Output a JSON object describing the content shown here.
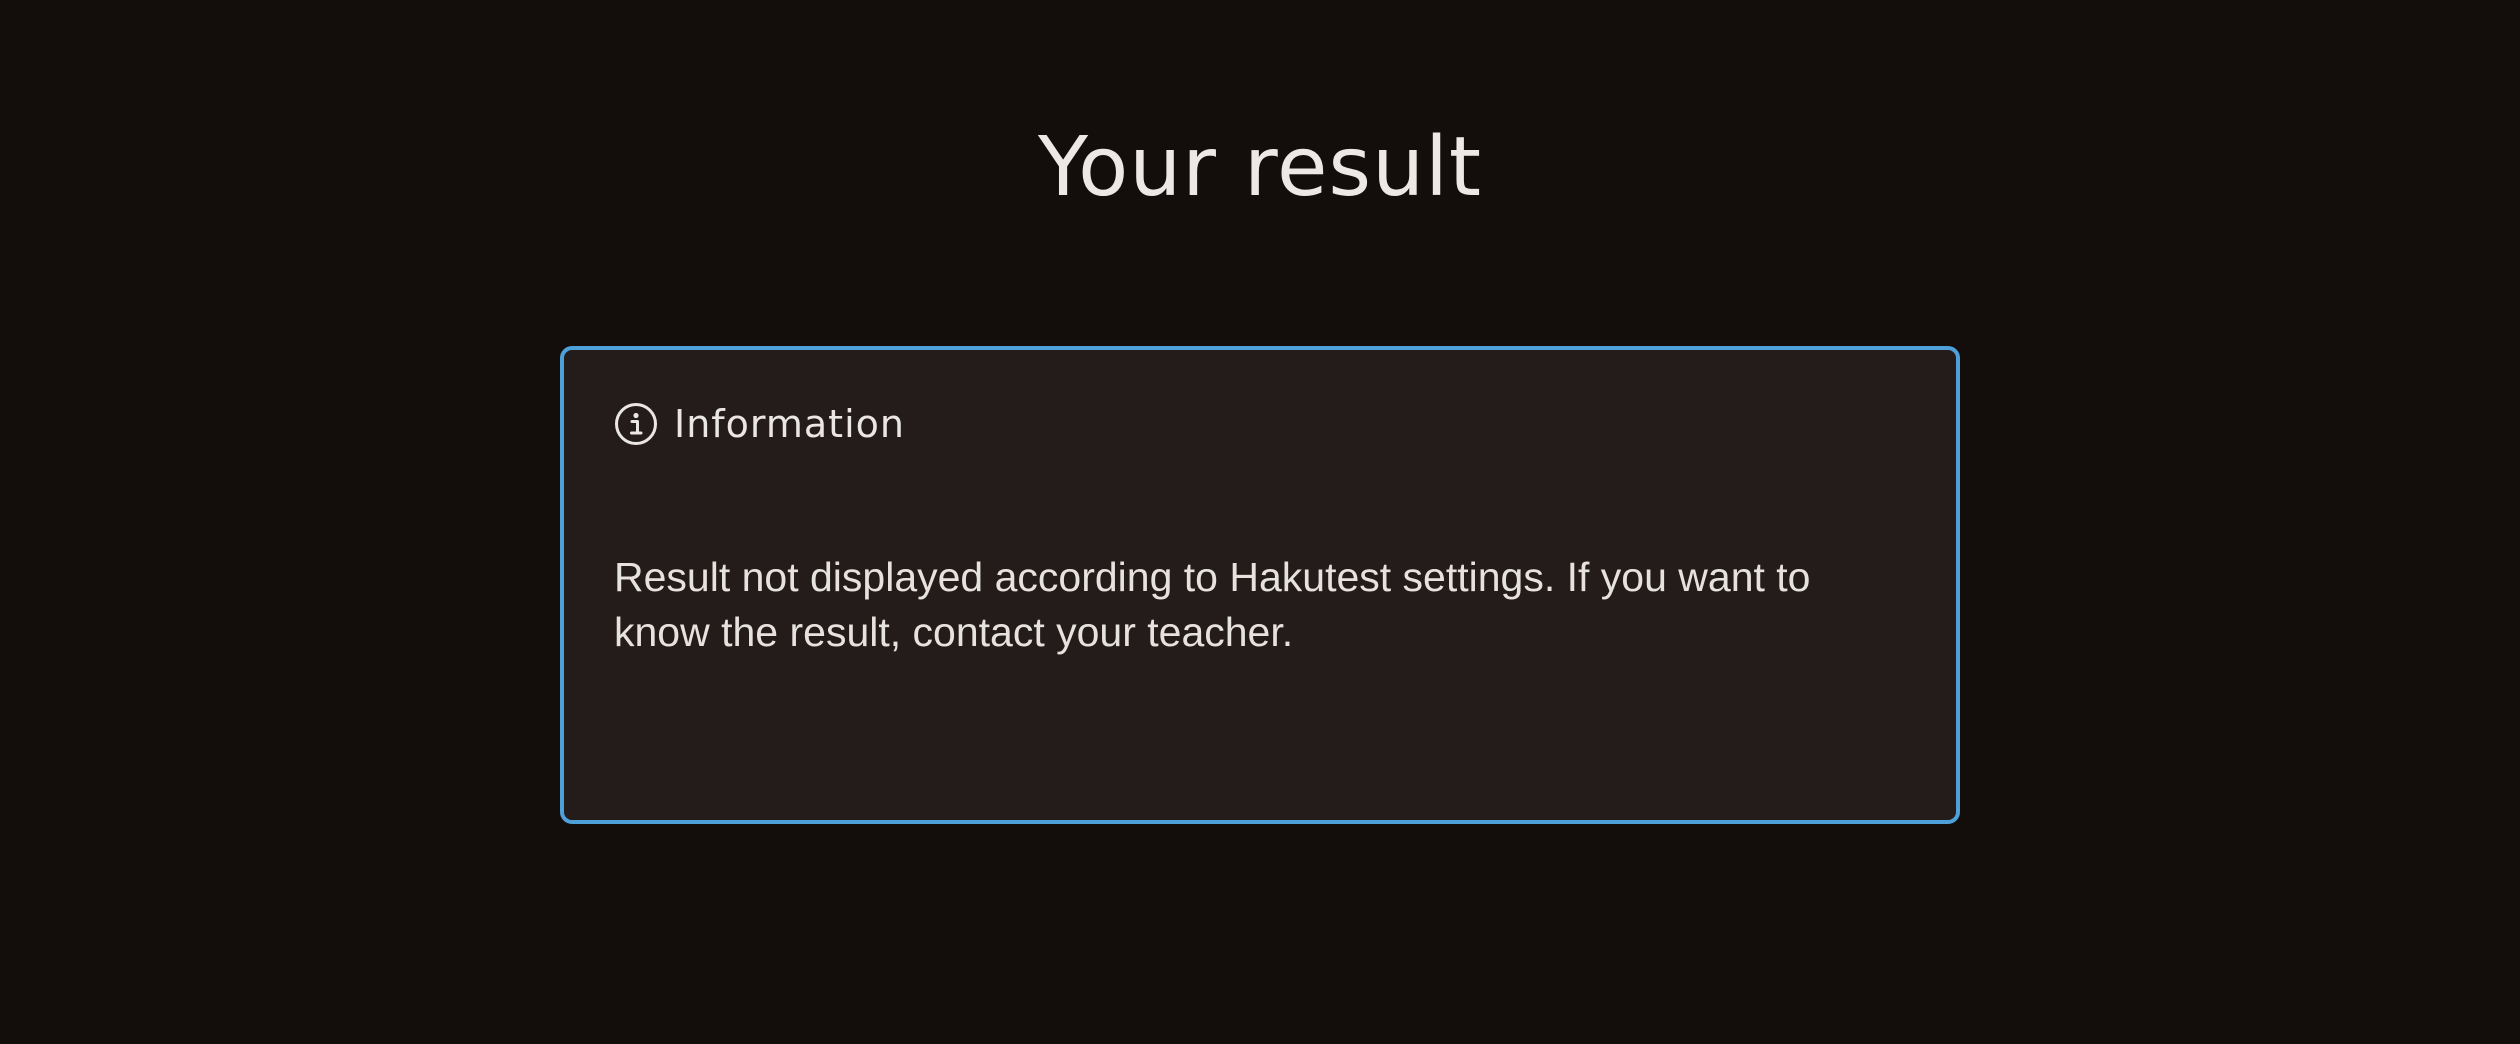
{
  "page": {
    "title": "Your result"
  },
  "info_card": {
    "icon": "info-circle-icon",
    "header": "Information",
    "message": "Result not displayed according to Hakutest settings. If you want to know the result, contact your teacher.",
    "border_color": "#4ea0d9"
  },
  "colors": {
    "background": "#130d0b",
    "card_background": "#231c1a",
    "text": "#e9e6e3"
  }
}
